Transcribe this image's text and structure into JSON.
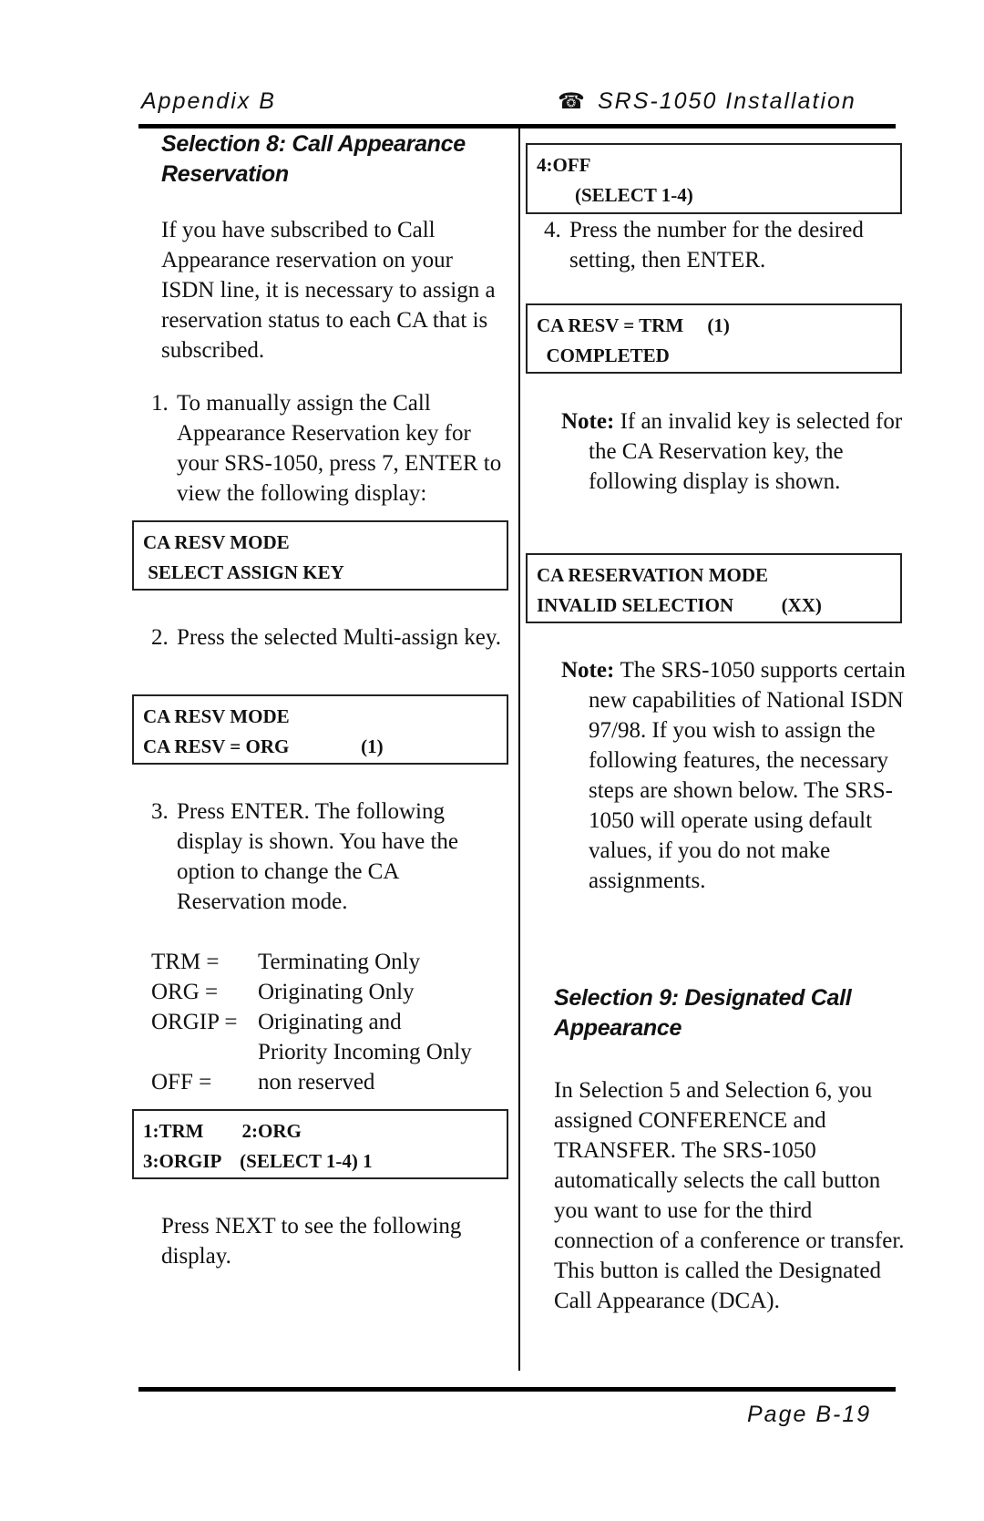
{
  "header": {
    "left": "Appendix B",
    "icon": "telephone-icon",
    "icon_glyph": "☎",
    "right": "SRS-1050 Installation"
  },
  "left_column": {
    "heading_line1": "Selection 8: Call Appearance",
    "heading_line2": "Reservation",
    "intro": "If you have subscribed to Call Appearance reservation on your ISDN line, it is necessary to assign a reservation status to each CA that is subscribed.",
    "step1_num": "1.",
    "step1": "To manually assign the Call Appearance Reservation key for your SRS-1050, press 7, ENTER to view the following display:",
    "display1": [
      "CA RESV MODE",
      " SELECT ASSIGN KEY"
    ],
    "step2_num": "2.",
    "step2": "Press the selected Multi-assign key.",
    "display2": [
      "CA RESV MODE",
      "CA RESV = ORG               (1)"
    ],
    "step3_num": "3.",
    "step3": "Press ENTER.  The following display is shown.  You have the option to change the CA Reservation mode.",
    "definitions": [
      {
        "key": "TRM =",
        "value": "Terminating Only"
      },
      {
        "key": "ORG =",
        "value": "Originating Only"
      },
      {
        "key": "ORGIP =",
        "value": "Originating and"
      },
      {
        "key": "",
        "value": "Priority Incoming Only"
      },
      {
        "key": "OFF =",
        "value": "non reserved"
      }
    ],
    "display3": [
      "1:TRM        2:ORG",
      "3:ORGIP    (SELECT 1-4) 1"
    ],
    "next_text": "Press NEXT to see the following display."
  },
  "right_column": {
    "display4": [
      "4:OFF",
      "        (SELECT 1-4)"
    ],
    "step4_num": "4.",
    "step4": "Press the number for the desired setting, then ENTER.",
    "display5": [
      "CA RESV = TRM     (1)",
      "  COMPLETED"
    ],
    "note1_label": "Note:",
    "note1": "If an invalid key is selected for the CA Reservation key, the following display is shown.",
    "display6": [
      "CA RESERVATION MODE",
      "INVALID SELECTION          (XX)"
    ],
    "note2_label": "Note:",
    "note2": "The SRS-1050 supports certain new capabilities of National ISDN 97/98.  If you wish to assign the following features, the necessary steps are shown below.  The SRS-1050 will operate using default values, if you do not make assignments.",
    "heading2_line1": "Selection 9:  Designated Call",
    "heading2_line2": "Appearance",
    "body": "In Selection 5 and Selection 6, you assigned CONFERENCE and TRANSFER.  The SRS-1050 automatically selects the call button you want to use for the third connection of a conference or transfer.  This button is called the Designated Call Appearance (DCA)."
  },
  "footer": {
    "page": "Page B-19"
  }
}
